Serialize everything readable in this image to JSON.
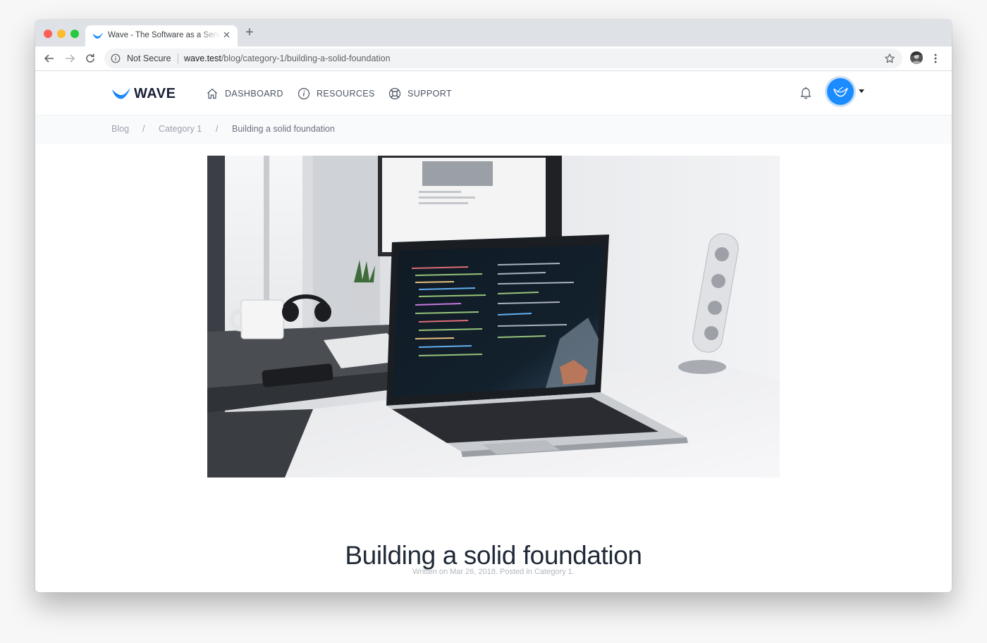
{
  "browser": {
    "tab_title": "Wave - The Software as a Service Starter Kit",
    "security_label": "Not Secure",
    "url_host": "wave.test",
    "url_path": "/blog/category-1/building-a-solid-foundation",
    "icons": [
      "back-icon",
      "forward-icon",
      "reload-icon",
      "info-icon",
      "star-icon",
      "profile-icon",
      "menu-icon",
      "close-icon",
      "new-tab-icon"
    ]
  },
  "header": {
    "logo_text": "WAVE",
    "nav": [
      {
        "label": "DASHBOARD",
        "icon": "home-icon"
      },
      {
        "label": "RESOURCES",
        "icon": "info-circle-icon"
      },
      {
        "label": "SUPPORT",
        "icon": "lifebuoy-icon"
      }
    ],
    "bell_icon": "bell-icon",
    "avatar_icon": "wave-avatar",
    "accent": "#1a8cff"
  },
  "breadcrumb": {
    "items": [
      "Blog",
      "Category 1",
      "Building a solid foundation"
    ],
    "separator": "/"
  },
  "post": {
    "title": "Building a solid foundation",
    "meta": "Written on Mar 26, 2018. Posted in Category 1.",
    "image": "laptop-on-desk-photo"
  }
}
